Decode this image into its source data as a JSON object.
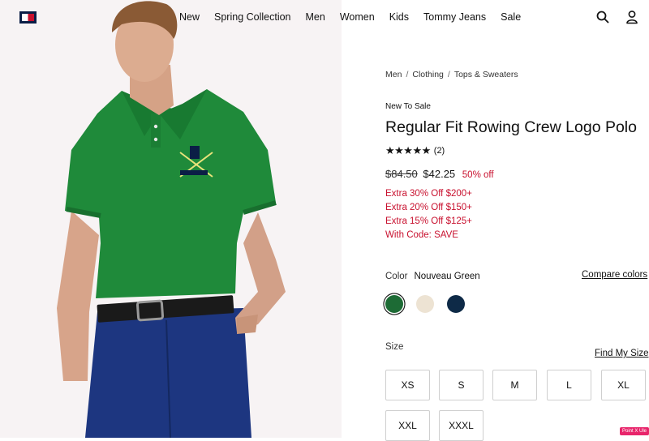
{
  "header": {
    "nav": [
      "New",
      "Spring Collection",
      "Men",
      "Women",
      "Kids",
      "Tommy Jeans",
      "Sale"
    ]
  },
  "breadcrumb": [
    "Men",
    "Clothing",
    "Tops & Sweaters"
  ],
  "product": {
    "tag": "New To Sale",
    "title": "Regular Fit Rowing Crew Logo Polo",
    "stars": "★★★★★",
    "review_count": "(2)",
    "original_price": "$84.50",
    "sale_price": "$42.25",
    "discount": "50% off",
    "promos": [
      "Extra 30% Off $200+",
      "Extra 20% Off $150+",
      "Extra 15% Off $125+",
      "With Code: SAVE"
    ],
    "color_label": "Color",
    "color_value": "Nouveau Green",
    "compare_colors": "Compare colors",
    "swatches": [
      {
        "name": "Nouveau Green",
        "color": "#1d6b35",
        "selected": true
      },
      {
        "name": "Cream",
        "color": "#ede3d3",
        "selected": false
      },
      {
        "name": "Navy",
        "color": "#0e2a47",
        "selected": false
      }
    ],
    "size_label": "Size",
    "find_my_size": "Find My Size",
    "sizes": [
      "XS",
      "S",
      "M",
      "L",
      "XL",
      "XXL",
      "XXXL"
    ]
  },
  "badge": "Point X Ule",
  "colors": {
    "accent_red": "#c8102e",
    "shirt_green": "#1f8a3a",
    "navy": "#0b1e46"
  }
}
